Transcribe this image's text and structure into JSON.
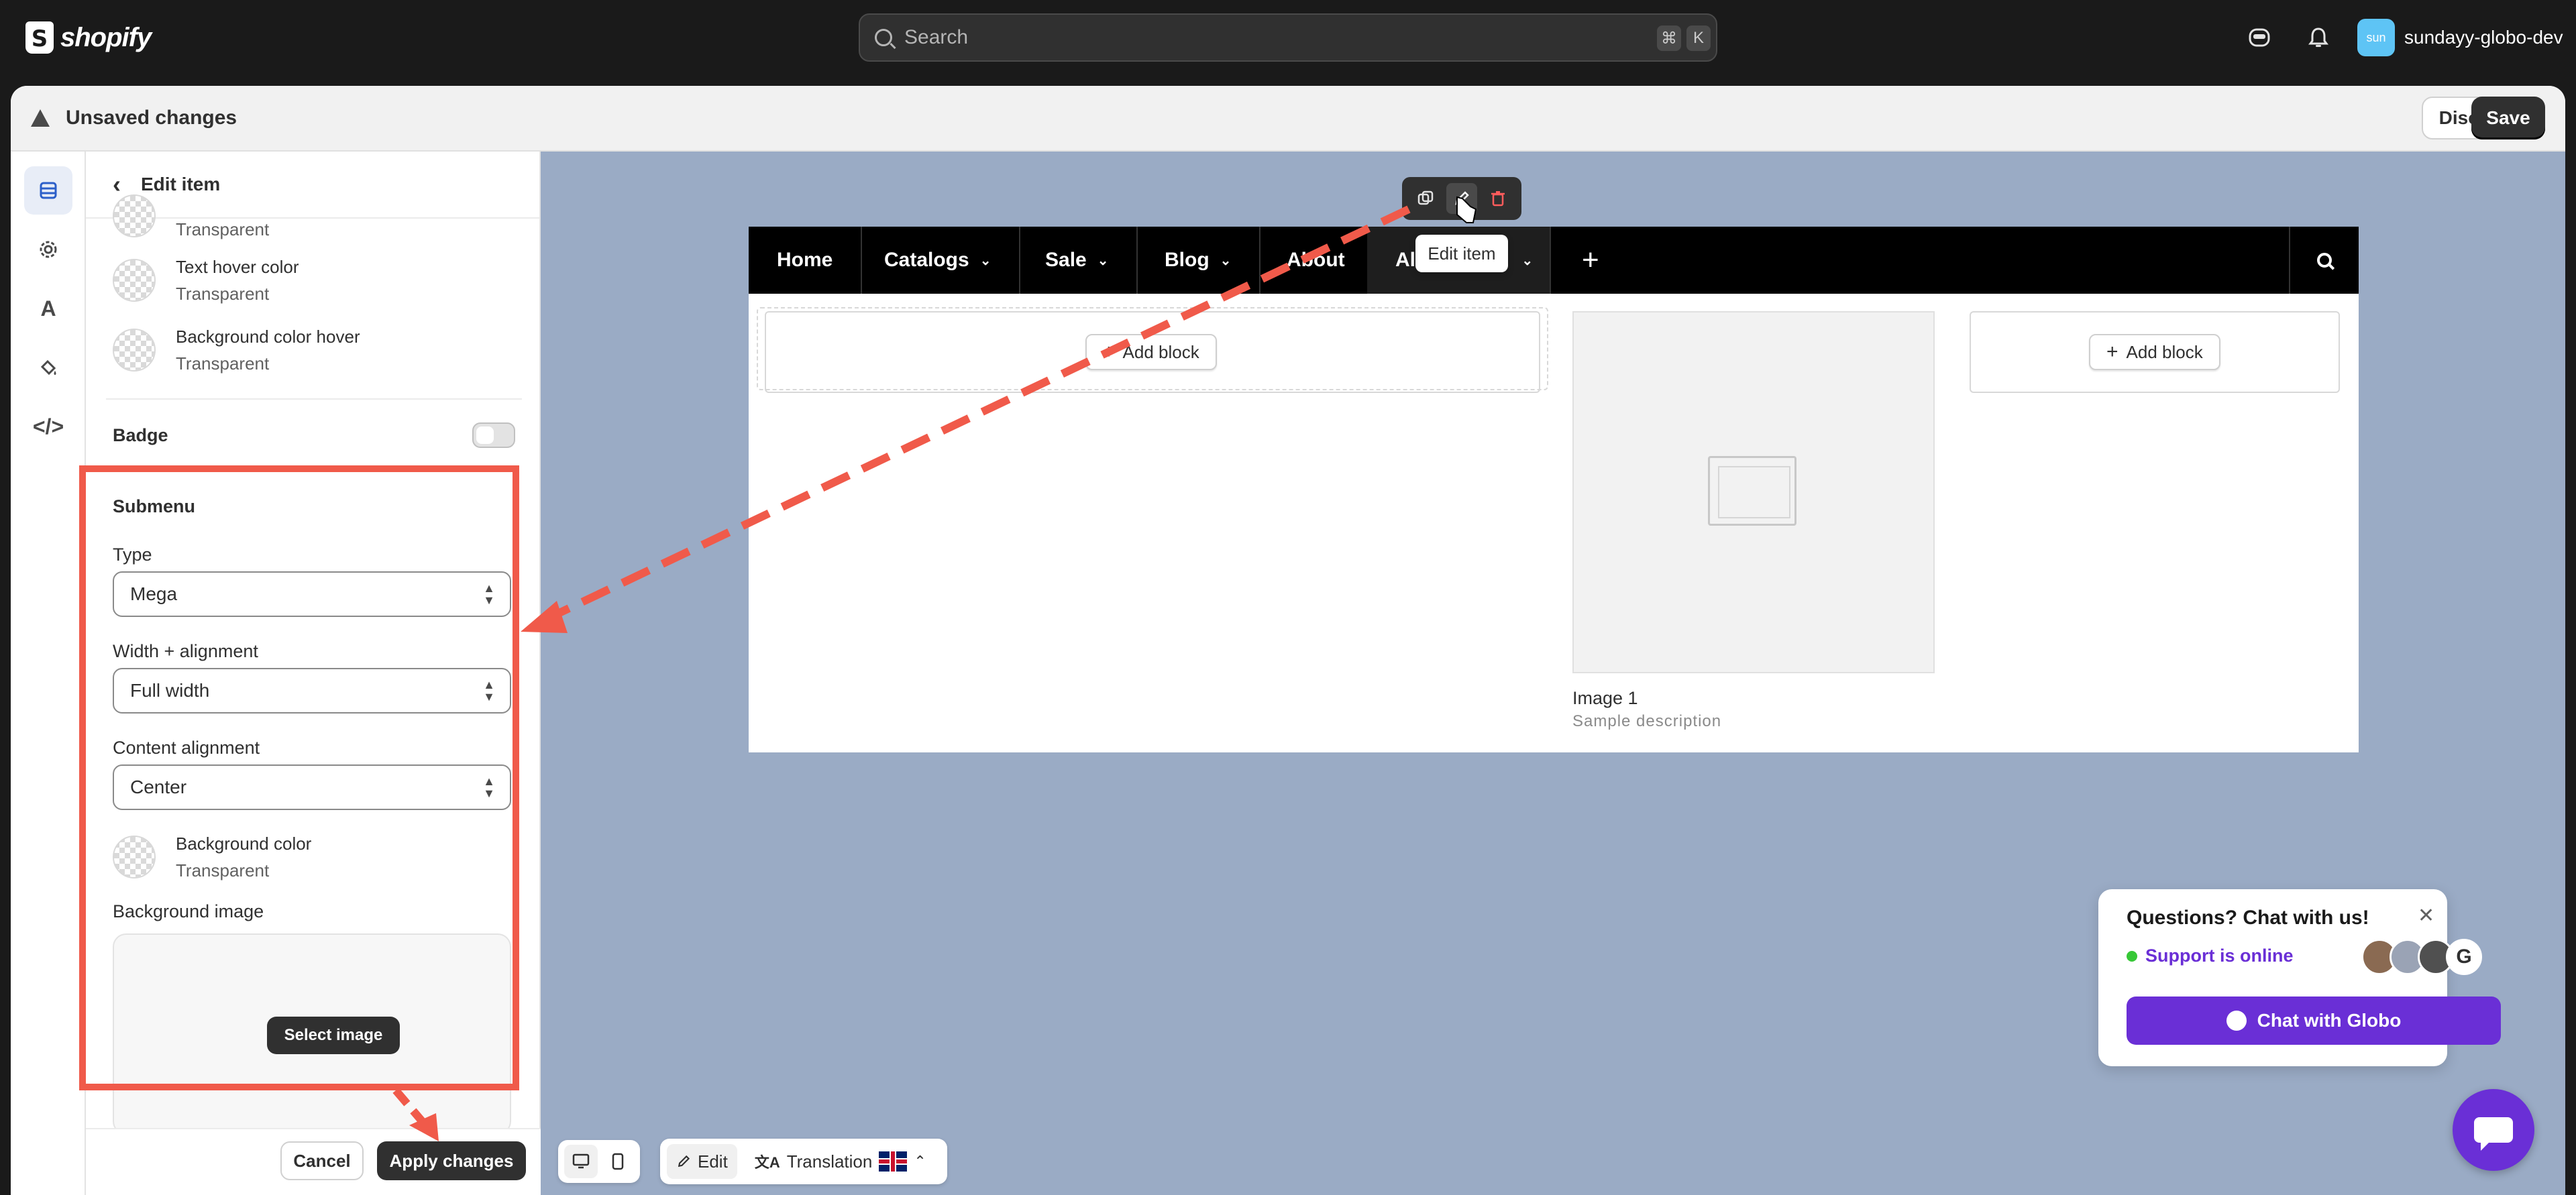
{
  "topbar": {
    "logo_text": "shopify",
    "search_placeholder": "Search",
    "shortcut_key1": "⌘",
    "shortcut_key2": "K",
    "store_avatar": "sun",
    "store_name": "sundayy-globo-dev"
  },
  "header": {
    "unsaved_label": "Unsaved changes",
    "discard_label": "Discard",
    "save_label": "Save"
  },
  "panel": {
    "title": "Edit item",
    "top_value": "Transparent",
    "text_hover_color": {
      "label": "Text hover color",
      "value": "Transparent"
    },
    "bg_color_hover": {
      "label": "Background color hover",
      "value": "Transparent"
    },
    "badge_label": "Badge",
    "submenu_heading": "Submenu",
    "type_label": "Type",
    "type_value": "Mega",
    "width_label": "Width + alignment",
    "width_value": "Full width",
    "content_align_label": "Content alignment",
    "content_align_value": "Center",
    "bg_color": {
      "label": "Background color",
      "value": "Transparent"
    },
    "bg_image_label": "Background image",
    "select_image_label": "Select image",
    "cancel_label": "Cancel",
    "apply_label": "Apply changes"
  },
  "preview": {
    "menu_items": [
      {
        "label": "Home",
        "has_dropdown": false
      },
      {
        "label": "Catalogs",
        "has_dropdown": true
      },
      {
        "label": "Sale",
        "has_dropdown": true
      },
      {
        "label": "Blog",
        "has_dropdown": true
      },
      {
        "label": "About",
        "has_dropdown": false
      },
      {
        "label": "All",
        "has_dropdown": true
      }
    ],
    "add_block_label": "Add block",
    "image_title": "Image 1",
    "image_desc": "Sample description",
    "tooltip": "Edit item"
  },
  "bottom_bar": {
    "edit_label": "Edit",
    "translation_label": "Translation"
  },
  "chat": {
    "question": "Questions? Chat with us!",
    "status": "Support is online",
    "button_label": "Chat with Globo"
  },
  "colors": {
    "accent_purple": "#6a2fd6",
    "annotation_red": "#f05a4a",
    "canvas_bg": "#9aabc5",
    "online_green": "#37c837"
  }
}
